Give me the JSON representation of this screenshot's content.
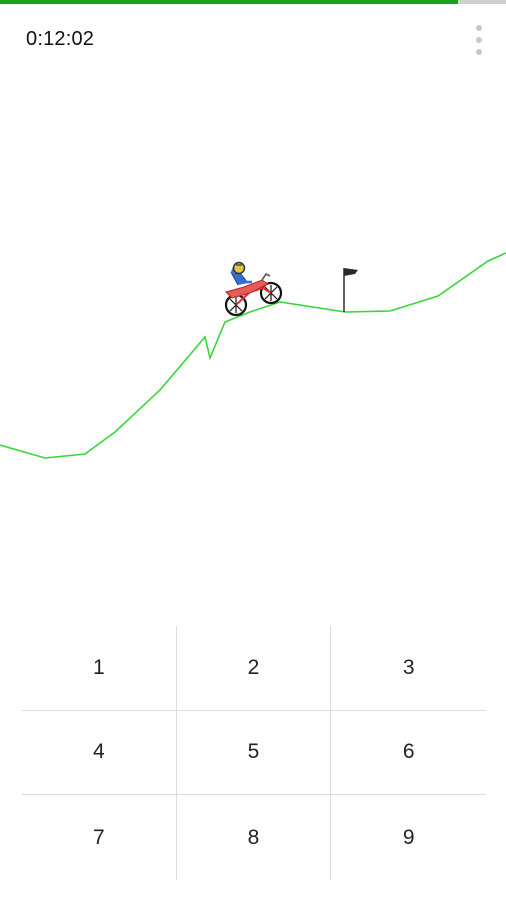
{
  "status": {
    "progress_fraction": 0.905,
    "progress_color": "#1aa31a",
    "timer": "0:12:02"
  },
  "menu": {
    "icon": "more-vert-icon"
  },
  "game": {
    "terrain_color": "#39d639",
    "finish_flag_icon": "finish-flag-icon",
    "rider_icon": "motorbike-rider-icon"
  },
  "keypad": {
    "keys": [
      {
        "label": "1"
      },
      {
        "label": "2"
      },
      {
        "label": "3"
      },
      {
        "label": "4"
      },
      {
        "label": "5"
      },
      {
        "label": "6"
      },
      {
        "label": "7"
      },
      {
        "label": "8"
      },
      {
        "label": "9"
      }
    ]
  }
}
